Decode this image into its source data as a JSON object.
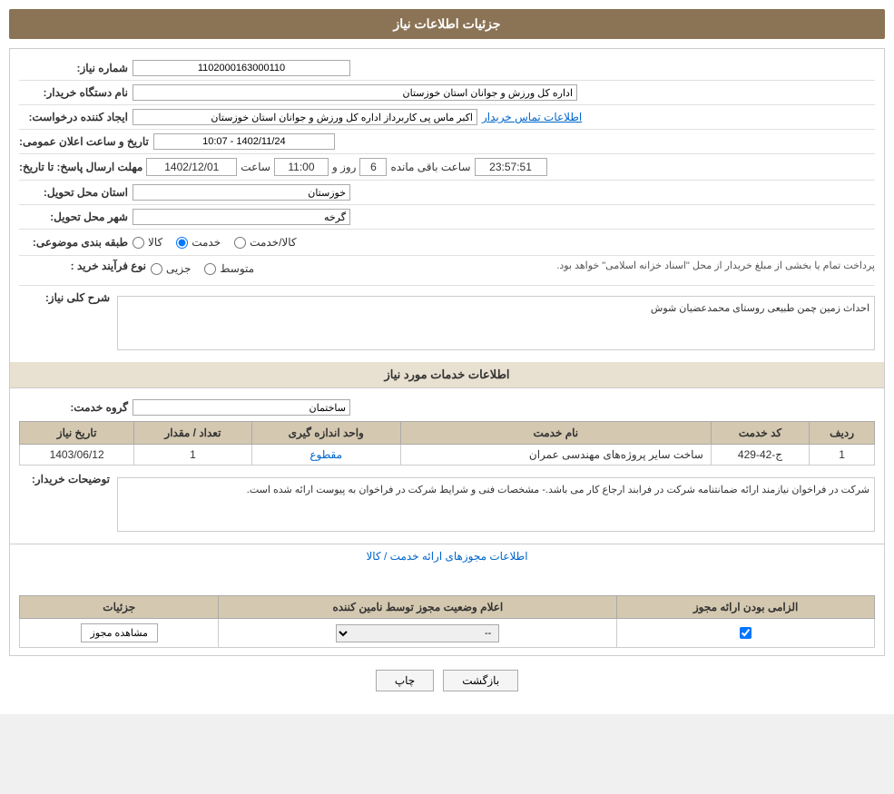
{
  "header": {
    "title": "جزئیات اطلاعات نیاز"
  },
  "fields": {
    "need_number_label": "شماره نیاز:",
    "need_number_value": "1102000163000110",
    "buyer_org_label": "نام دستگاه خریدار:",
    "buyer_org_value": "اداره کل ورزش و جوانان استان خوزستان",
    "requester_label": "ایجاد کننده درخواست:",
    "requester_value": "اکبر ماس پی کاربرداز اداره کل ورزش و جوانان استان خوزستان",
    "requester_link": "اطلاعات تماس خریدار",
    "announce_date_label": "تاریخ و ساعت اعلان عمومی:",
    "announce_date_value": "1402/11/24 - 10:07",
    "deadline_label": "مهلت ارسال پاسخ: تا تاریخ:",
    "deadline_date": "1402/12/01",
    "deadline_time_label": "ساعت",
    "deadline_time": "11:00",
    "deadline_days_label": "روز و",
    "deadline_days": "6",
    "deadline_remaining_label": "ساعت باقی مانده",
    "deadline_remaining": "23:57:51",
    "province_label": "استان محل تحویل:",
    "province_value": "خوزستان",
    "city_label": "شهر محل تحویل:",
    "city_value": "گرخه",
    "category_label": "طبقه بندی موضوعی:",
    "category_options": [
      "کالا",
      "خدمت",
      "کالا/خدمت"
    ],
    "category_selected": "خدمت",
    "purchase_type_label": "نوع فرآیند خرید :",
    "purchase_options": [
      "جزیی",
      "متوسط"
    ],
    "purchase_note": "پرداخت تمام یا بخشی از مبلغ خریدار از محل \"اسناد خزانه اسلامی\" خواهد بود.",
    "need_description_label": "شرح کلی نیاز:",
    "need_description_value": "احداث زمین چمن طبیعی روستای محمدعضیان شوش"
  },
  "services_section": {
    "title": "اطلاعات خدمات مورد نیاز",
    "service_group_label": "گروه خدمت:",
    "service_group_value": "ساختمان",
    "table": {
      "headers": [
        "ردیف",
        "کد خدمت",
        "نام خدمت",
        "واحد اندازه گیری",
        "تعداد / مقدار",
        "تاریخ نیاز"
      ],
      "rows": [
        {
          "row_num": "1",
          "service_code": "ج-42-429",
          "service_name": "ساخت سایر پروژه‌های مهندسی عمران",
          "unit": "مقطوع",
          "quantity": "1",
          "date": "1403/06/12"
        }
      ]
    }
  },
  "buyer_notes": {
    "label": "توضیحات خریدار:",
    "value": "شرکت در فراخوان نیازمند ارائه ضمانتنامه شرکت در فرابند ارجاع کار می باشد.- مشخصات فنی و شرایط شرکت در فراخوان به پیوست ارائه شده است."
  },
  "permissions_section": {
    "link_title": "اطلاعات مجوزهای ارائه خدمت / کالا",
    "table": {
      "headers": [
        "الزامی بودن ارائه مجوز",
        "اعلام وضعیت مجوز توسط نامین کننده",
        "جزئیات"
      ],
      "rows": [
        {
          "required": true,
          "status": "--",
          "details_btn": "مشاهده مجوز"
        }
      ]
    }
  },
  "buttons": {
    "print": "چاپ",
    "back": "بازگشت"
  }
}
